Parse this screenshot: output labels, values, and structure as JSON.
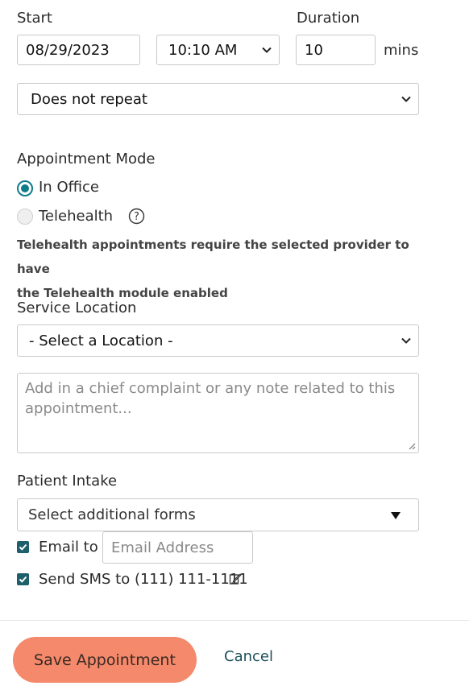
{
  "start": {
    "label": "Start",
    "date": "08/29/2023",
    "time": "10:10 AM"
  },
  "duration": {
    "label": "Duration",
    "value": "10",
    "unit": "mins"
  },
  "repeat": {
    "value": "Does not repeat"
  },
  "mode": {
    "label": "Appointment Mode",
    "options": [
      {
        "label": "In Office",
        "selected": true
      },
      {
        "label": "Telehealth",
        "selected": false
      }
    ],
    "help_icon": "question-circle-icon",
    "note_line1": "Telehealth appointments require the selected provider to have",
    "note_line2": "the Telehealth module enabled"
  },
  "location": {
    "label": "Service Location",
    "value": "- Select a Location -"
  },
  "notes": {
    "placeholder_line1": "Add in a chief complaint or any note related to this",
    "placeholder_line2": "appointment..."
  },
  "intake": {
    "label": "Patient Intake",
    "forms_placeholder": "Select additional forms",
    "email_label": "Email to",
    "email_placeholder": "Email Address",
    "sms_label": "Send SMS to (111) 111-1111",
    "email_checked": true,
    "sms_checked": true
  },
  "actions": {
    "save": "Save Appointment",
    "cancel": "Cancel"
  },
  "colors": {
    "accent": "#0e7b8a",
    "save_button": "#f4896b",
    "checkbox": "#1d5f6b"
  }
}
